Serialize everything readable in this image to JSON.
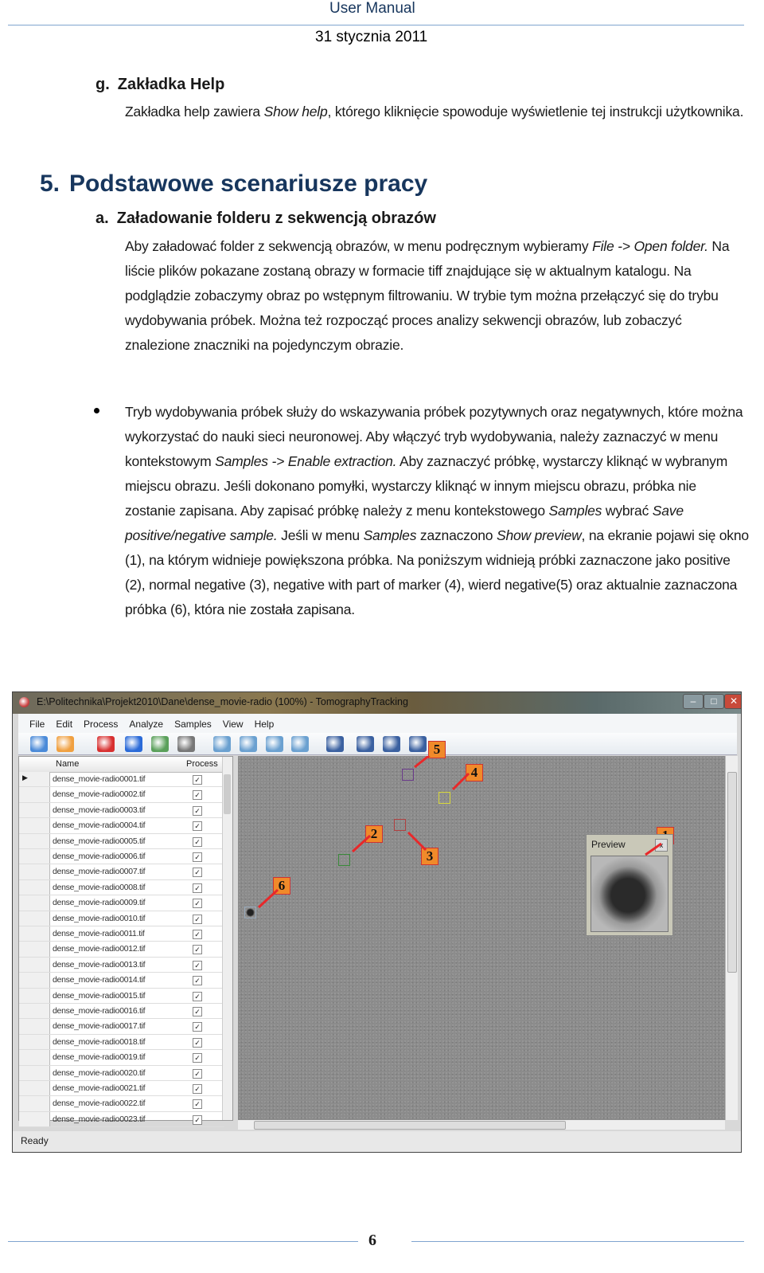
{
  "header": {
    "title": "User Manual",
    "date": "31 stycznia 2011"
  },
  "section_g": {
    "marker": "g.",
    "title": "Zakładka Help",
    "paragraph": [
      {
        "t": "Zakładka help zawiera "
      },
      {
        "t": "Show help",
        "i": true
      },
      {
        "t": ", którego kliknięcie spowoduje wyświetlenie tej instrukcji użytkownika."
      }
    ]
  },
  "section_5": {
    "number": "5.",
    "title": "Podstawowe scenariusze pracy"
  },
  "section_a": {
    "marker": "a.",
    "title": "Załadowanie folderu z sekwencją obrazów",
    "paragraph": [
      {
        "t": "Aby załadować folder z sekwencją obrazów, w menu podręcznym wybieramy "
      },
      {
        "t": "File -> Open folder.",
        "i": true
      },
      {
        "t": " Na liście plików pokazane zostaną obrazy w formacie tiff znajdujące się w aktualnym katalogu. Na podglądzie zobaczymy obraz po wstępnym filtrowaniu. W trybie tym można przełączyć się do trybu wydobywania próbek. Można też rozpocząć proces analizy sekwencji obrazów, lub zobaczyć znalezione znaczniki na pojedynczym obrazie."
      }
    ]
  },
  "bullet": {
    "paragraph": [
      {
        "t": "Tryb wydobywania próbek służy do wskazywania próbek pozytywnych oraz negatywnych, które można wykorzystać do nauki sieci neuronowej. Aby włączyć tryb wydobywania, należy zaznaczyć w menu kontekstowym "
      },
      {
        "t": "Samples -> Enable extraction.",
        "i": true
      },
      {
        "t": " Aby zaznaczyć próbkę, wystarczy kliknąć w wybranym miejscu obrazu. Jeśli dokonano pomyłki, wystarczy kliknąć w innym miejscu obrazu, próbka nie zostanie zapisana. Aby zapisać próbkę należy z menu kontekstowego "
      },
      {
        "t": "Samples",
        "i": true
      },
      {
        "t": " wybrać "
      },
      {
        "t": "Save positive/negative sample.",
        "i": true
      },
      {
        "t": " Jeśli w menu "
      },
      {
        "t": "Samples",
        "i": true
      },
      {
        "t": " zaznaczono "
      },
      {
        "t": "Show preview",
        "i": true
      },
      {
        "t": ", na ekranie pojawi się okno (1), na którym widnieje powiększona próbka. Na poniższym widnieją próbki zaznaczone jako positive (2), normal negative (3), negative with part of marker (4), wierd negative(5) oraz aktualnie zaznaczona próbka (6), która nie została zapisana."
      }
    ]
  },
  "screenshot": {
    "window_title": "E:\\Politechnika\\Projekt2010\\Dane\\dense_movie-radio (100%) - TomographyTracking",
    "menu": [
      "File",
      "Edit",
      "Process",
      "Analyze",
      "Samples",
      "View",
      "Help"
    ],
    "toolbar_icons": [
      "open-folder-icon",
      "open-folder-add-icon",
      "checker-icon",
      "play-icon",
      "edit-image-icon",
      "brain-icon",
      "zoom-in-icon",
      "zoom-out-icon",
      "zoom-reset-icon",
      "zoom-fit-icon",
      "save-green-icon",
      "save-red-icon",
      "save-multicolor-icon",
      "save-purple-icon"
    ],
    "list_columns": {
      "name": "Name",
      "process": "Process"
    },
    "files": [
      "dense_movie-radio0001.tif",
      "dense_movie-radio0002.tif",
      "dense_movie-radio0003.tif",
      "dense_movie-radio0004.tif",
      "dense_movie-radio0005.tif",
      "dense_movie-radio0006.tif",
      "dense_movie-radio0007.tif",
      "dense_movie-radio0008.tif",
      "dense_movie-radio0009.tif",
      "dense_movie-radio0010.tif",
      "dense_movie-radio0011.tif",
      "dense_movie-radio0012.tif",
      "dense_movie-radio0013.tif",
      "dense_movie-radio0014.tif",
      "dense_movie-radio0015.tif",
      "dense_movie-radio0016.tif",
      "dense_movie-radio0017.tif",
      "dense_movie-radio0018.tif",
      "dense_movie-radio0019.tif",
      "dense_movie-radio0020.tif",
      "dense_movie-radio0021.tif",
      "dense_movie-radio0022.tif",
      "dense_movie-radio0023.tif"
    ],
    "preview_title": "Preview",
    "status": "Ready",
    "callouts": [
      "1",
      "2",
      "3",
      "4",
      "5",
      "6"
    ],
    "sample_colors": {
      "positive": "#3a8a3a",
      "normal_negative": "#b04040",
      "negative_with_marker": "#d8d83a",
      "wierd_negative": "#6a3a8a",
      "current": "#333333"
    },
    "annotation_color": "#e8282a",
    "callout_fill": "#f08a2a"
  },
  "footer": {
    "page_number": "6"
  }
}
